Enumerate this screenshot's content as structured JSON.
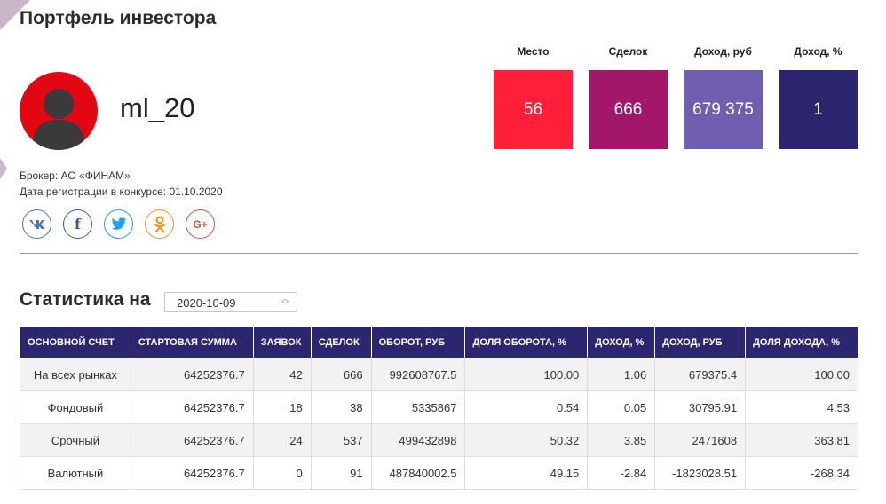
{
  "page_title": "Портфель инвестора",
  "user": {
    "username": "ml_20",
    "broker_label": "Брокер:",
    "broker_value": "АО «ФИНАМ»",
    "reg_label": "Дата регистрации в конкурсе:",
    "reg_value": "01.10.2020"
  },
  "stats": [
    {
      "label": "Место",
      "value": "56",
      "color": "#ff1f3a"
    },
    {
      "label": "Сделок",
      "value": "666",
      "color": "#a3176b"
    },
    {
      "label": "Доход, руб",
      "value": "679 375",
      "color": "#6f5fae"
    },
    {
      "label": "Доход, %",
      "value": "1",
      "color": "#2c2670"
    }
  ],
  "socials": [
    {
      "name": "vk-icon",
      "glyph": "VK",
      "color": "#4a76a8"
    },
    {
      "name": "facebook-icon",
      "glyph": "f",
      "color": "#3b5998"
    },
    {
      "name": "twitter-icon",
      "glyph": "t",
      "color": "#1da1f2"
    },
    {
      "name": "odnoklassniki-icon",
      "glyph": "ok",
      "color": "#f7931e"
    },
    {
      "name": "google-plus-icon",
      "glyph": "G+",
      "color": "#dd4b39"
    }
  ],
  "statistics": {
    "heading": "Статистика на",
    "date_value": "2020-10-09"
  },
  "table": {
    "headers": [
      "ОСНОВНОЙ СЧЕТ",
      "СТАРТОВАЯ СУММА",
      "ЗАЯВОК",
      "СДЕЛОК",
      "ОБОРОТ, РУБ",
      "ДОЛЯ ОБОРОТА, %",
      "ДОХОД, %",
      "ДОХОД, РУБ",
      "ДОЛЯ ДОХОДА, %"
    ],
    "rows": [
      [
        "На всех рынках",
        "64252376.7",
        "42",
        "666",
        "992608767.5",
        "100.00",
        "1.06",
        "679375.4",
        "100.00"
      ],
      [
        "Фондовый",
        "64252376.7",
        "18",
        "38",
        "5335867",
        "0.54",
        "0.05",
        "30795.91",
        "4.53"
      ],
      [
        "Срочный",
        "64252376.7",
        "24",
        "537",
        "499432898",
        "50.32",
        "3.85",
        "2471608",
        "363.81"
      ],
      [
        "Валютный",
        "64252376.7",
        "0",
        "91",
        "487840002.5",
        "49.15",
        "-2.84",
        "-1823028.51",
        "-268.34"
      ]
    ]
  }
}
